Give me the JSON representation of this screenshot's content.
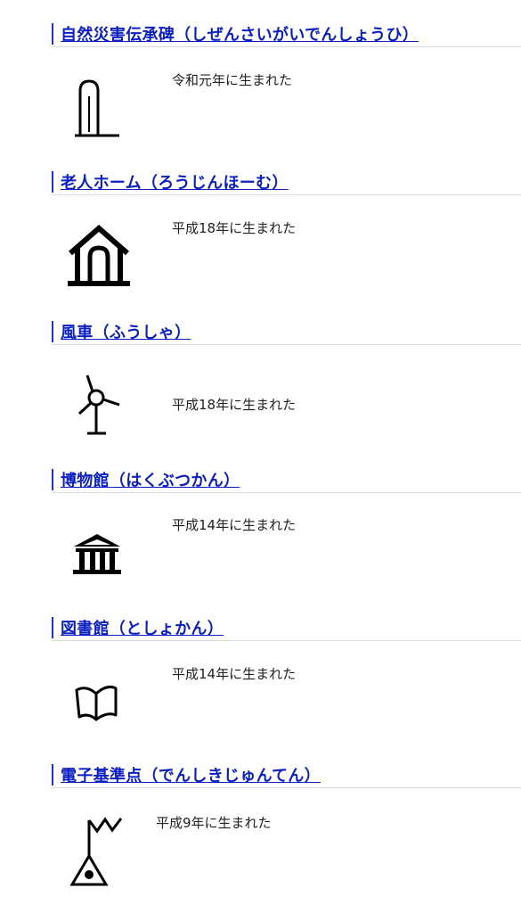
{
  "sections": [
    {
      "title": "自然災害伝承碑（しぜんさいがいでんしょうひ）",
      "icon": "monument-icon",
      "desc": "令和元年に生まれた"
    },
    {
      "title": "老人ホーム（ろうじんほーむ）",
      "icon": "nursing-home-icon",
      "desc": "平成18年に生まれた"
    },
    {
      "title": "風車（ふうしゃ）",
      "icon": "windmill-icon",
      "desc": "平成18年に生まれた"
    },
    {
      "title": "博物館（はくぶつかん）",
      "icon": "museum-icon",
      "desc": "平成14年に生まれた"
    },
    {
      "title": "図書館（としょかん）",
      "icon": "library-icon",
      "desc": "平成14年に生まれた"
    },
    {
      "title": "電子基準点（でんしきじゅんてん）",
      "icon": "gnss-station-icon",
      "desc": "平成9年に生まれた"
    }
  ],
  "colors": {
    "link": "#0b1fc2",
    "accent_bar": "#1a35c8",
    "text": "#222222"
  }
}
